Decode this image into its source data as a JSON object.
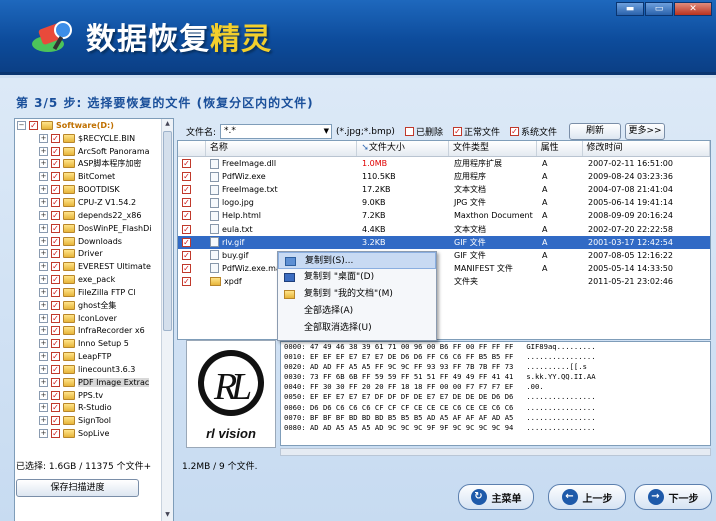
{
  "app": {
    "title_main": "数据恢复",
    "title_accent": "精灵",
    "window_buttons": [
      "▬",
      "▭",
      "✕"
    ]
  },
  "step_text": "第 3/5 步: 选择要恢复的文件 (恢复分区内的文件)",
  "tree": {
    "root": "Software(D:)",
    "items": [
      "$RECYCLE.BIN",
      "ArcSoft Panorama",
      "ASP脚本程序加密",
      "BitComet",
      "BOOTDISK",
      "CPU-Z V1.54.2",
      "depends22_x86",
      "DosWinPE_FlashDi",
      "Downloads",
      "Driver",
      "EVEREST Ultimate",
      "exe_pack",
      "FileZilla FTP Cl",
      "ghost全集",
      "IconLover",
      "InfraRecorder x6",
      "Inno Setup 5",
      "LeapFTP",
      "linecount3.6.3",
      "PDF Image Extrac",
      "PPS.tv",
      "R-Studio",
      "SignTool",
      "SopLive"
    ],
    "selected_index": 19
  },
  "filter": {
    "label": "文件名:",
    "value": "*.*",
    "hint": "(*.jpg;*.bmp)",
    "deleted": "已删除",
    "normal": "正常文件",
    "system": "系统文件",
    "refresh": "刷新",
    "more": "更多>>"
  },
  "columns": [
    "名称",
    "文件大小",
    "文件类型",
    "属性",
    "修改时间"
  ],
  "files": [
    {
      "name": "FreeImage.dll",
      "size": "1.0MB",
      "type": "应用程序扩展",
      "attr": "A",
      "time": "2007-02-11 16:51:00",
      "red": true
    },
    {
      "name": "PdfWiz.exe",
      "size": "110.5KB",
      "type": "应用程序",
      "attr": "A",
      "time": "2009-08-24 03:23:36"
    },
    {
      "name": "FreeImage.txt",
      "size": "17.2KB",
      "type": "文本文档",
      "attr": "A",
      "time": "2004-07-08 21:41:04"
    },
    {
      "name": "logo.jpg",
      "size": "9.0KB",
      "type": "JPG 文件",
      "attr": "A",
      "time": "2005-06-14 19:41:14"
    },
    {
      "name": "Help.html",
      "size": "7.2KB",
      "type": "Maxthon Document",
      "attr": "A",
      "time": "2008-09-09 20:16:24"
    },
    {
      "name": "eula.txt",
      "size": "4.4KB",
      "type": "文本文档",
      "attr": "A",
      "time": "2002-07-20 22:22:58"
    },
    {
      "name": "rlv.gif",
      "size": "3.2KB",
      "type": "GIF 文件",
      "attr": "A",
      "time": "2001-03-17 12:42:54",
      "selected": true
    },
    {
      "name": "buy.gif",
      "size": "",
      "type": "GIF 文件",
      "attr": "A",
      "time": "2007-08-05 12:16:22"
    },
    {
      "name": "PdfWiz.exe.man",
      "size": "",
      "type": "MANIFEST 文件",
      "attr": "A",
      "time": "2005-05-14 14:33:50"
    },
    {
      "name": "xpdf",
      "size": "",
      "type": "文件夹",
      "attr": "",
      "time": "2011-05-21 23:02:46",
      "folder": true
    }
  ],
  "context_menu": [
    "复制到(S)...",
    "复制到 \"桌面\"(D)",
    "复制到 \"我的文档\"(M)",
    "全部选择(A)",
    "全部取消选择(U)"
  ],
  "preview_caption": "rl vision",
  "hex_lines": [
    "0000: 47 49 46 38 39 61 71 00 96 00 B6 FF 00 FF FF FF   GIF89aq.........",
    "0010: EF EF EF E7 E7 E7 DE D6 D6 FF C6 C6 FF B5 B5 FF   ................",
    "0020: AD AD FF A5 A5 FF 9C 9C FF 93 93 FF 7B 7B FF 73   ..........[[.s",
    "0030: 73 FF 6B 6B FF 59 59 FF 51 51 FF 49 49 FF 41 41   s.kk.YY.QQ.II.AA",
    "0040: FF 30 30 FF 20 20 FF 18 18 FF 00 00 F7 F7 F7 EF   .00.",
    "0050: EF EF E7 E7 E7 DF DF DF DE E7 E7 DE DE DE D6 D6   ................",
    "0060: D6 D6 C6 C6 C6 CF CF CF CE CE CE C6 CE CE C6 C6   ................",
    "0070: BF BF BF BD BD BD B5 B5 B5 AD A5 AF AF AF AD A5   ................",
    "0080: AD AD A5 A5 A5 AD 9C 9C 9C 9F 9F 9C 9C 9C 9C 94   ................"
  ],
  "status": {
    "selected": "已选择: 1.6GB / 11375 个文件+",
    "current": "1.2MB / 9 个文件."
  },
  "buttons": {
    "save_scan": "保存扫描进度",
    "main_menu": "主菜单",
    "prev": "上一步",
    "next": "下一步"
  }
}
